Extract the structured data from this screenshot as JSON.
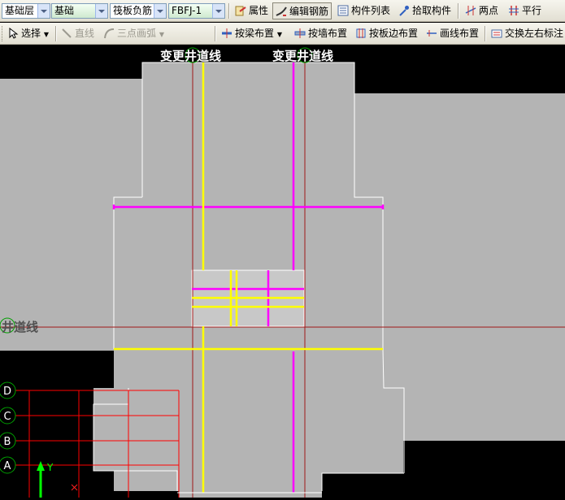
{
  "toolbar1": {
    "layer_select": "基础层",
    "type_select": "基础",
    "component_select": "筏板负筋",
    "name_select": "FBFJ-1",
    "properties_label": "属性",
    "edit_rebar_label": "编辑钢筋",
    "component_list_label": "构件列表",
    "pick_component_label": "拾取构件",
    "two_points_label": "两点",
    "parallel_label": "平行"
  },
  "toolbar2": {
    "select_label": "选择",
    "line_label": "直线",
    "arc_label": "三点画弧",
    "by_beam_label": "按梁布置",
    "by_wall_label": "按墙布置",
    "by_slab_edge_label": "按板边布置",
    "draw_line_label": "画线布置",
    "swap_label": "交换左右标注"
  },
  "canvas": {
    "axis_label_top_left": "变更井道线",
    "axis_label_top_right": "变更井道线",
    "axis_label_left": "井道线",
    "axis_bubbles": [
      "D",
      "C",
      "B",
      "A"
    ],
    "ucs_y_label": "Y",
    "colors": {
      "background": "#000000",
      "slab_fill": "#b4b4b4",
      "slab_edge": "#ffffff",
      "rebar_magenta": "#ff00ff",
      "rebar_yellow": "#ffff00",
      "axis_line": "#a01818",
      "axis_bubble": "#00a000",
      "grid_red": "#ff0000"
    }
  }
}
